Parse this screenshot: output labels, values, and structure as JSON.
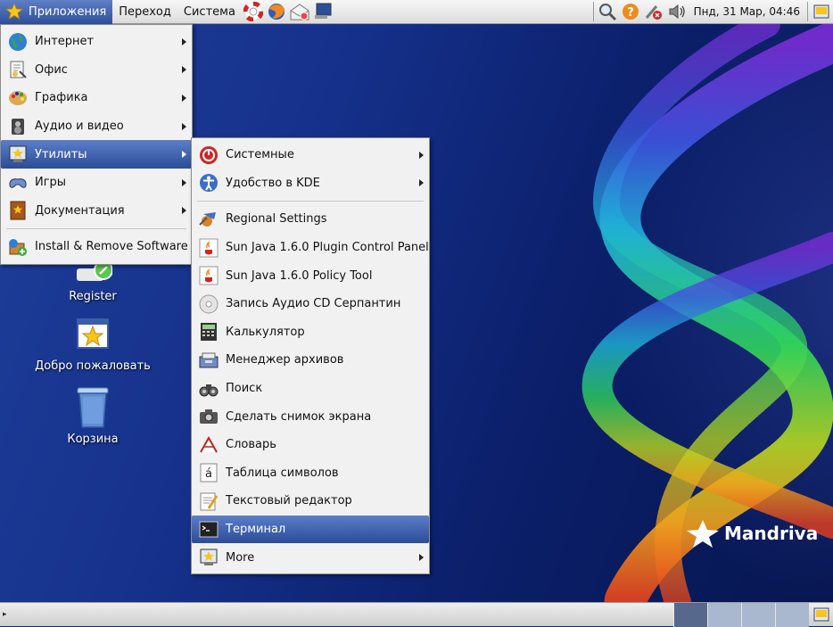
{
  "panel": {
    "menus": [
      "Приложения",
      "Переход",
      "Система"
    ],
    "clock": "Пнд, 31 Мар, 04:46"
  },
  "main_menu": {
    "items": [
      {
        "label": "Интернет",
        "icon": "globe-icon",
        "submenu": true
      },
      {
        "label": "Офис",
        "icon": "office-icon",
        "submenu": true
      },
      {
        "label": "Графика",
        "icon": "palette-icon",
        "submenu": true
      },
      {
        "label": "Аудио и видео",
        "icon": "speaker-icon",
        "submenu": true
      },
      {
        "label": "Утилиты",
        "icon": "utilities-icon",
        "submenu": true,
        "highlighted": true
      },
      {
        "label": "Игры",
        "icon": "gamepad-icon",
        "submenu": true
      },
      {
        "label": "Документация",
        "icon": "book-icon",
        "submenu": true
      }
    ],
    "bottom_item": {
      "label": "Install & Remove Software",
      "icon": "package-icon"
    }
  },
  "utilities_menu": {
    "top_items": [
      {
        "label": "Системные",
        "icon": "system-icon",
        "submenu": true
      },
      {
        "label": "Удобство в KDE",
        "icon": "accessibility-icon",
        "submenu": true
      }
    ],
    "items": [
      {
        "label": "Regional Settings",
        "icon": "regional-icon"
      },
      {
        "label": "Sun Java 1.6.0 Plugin Control Panel",
        "icon": "java-icon"
      },
      {
        "label": "Sun Java 1.6.0 Policy Tool",
        "icon": "java-icon"
      },
      {
        "label": "Запись Аудио CD Серпантин",
        "icon": "cd-icon"
      },
      {
        "label": "Калькулятор",
        "icon": "calculator-icon"
      },
      {
        "label": "Менеджер архивов",
        "icon": "archive-icon"
      },
      {
        "label": "Поиск",
        "icon": "binoculars-icon"
      },
      {
        "label": "Сделать снимок экрана",
        "icon": "camera-icon"
      },
      {
        "label": "Словарь",
        "icon": "dictionary-icon"
      },
      {
        "label": "Таблица символов",
        "icon": "charmap-icon"
      },
      {
        "label": "Текстовый редактор",
        "icon": "text-editor-icon"
      },
      {
        "label": "Терминал",
        "icon": "terminal-icon",
        "highlighted": true
      },
      {
        "label": "More",
        "icon": "more-icon",
        "submenu": true
      }
    ]
  },
  "desktop": {
    "icons": [
      {
        "label": "Register",
        "icon": "register-icon"
      },
      {
        "label": "Добро пожаловать",
        "icon": "welcome-icon"
      },
      {
        "label": "Корзина",
        "icon": "trash-icon"
      }
    ],
    "brand": "Mandriva"
  },
  "colors": {
    "highlight": "#2b4c98",
    "desktop": "#15308a"
  }
}
